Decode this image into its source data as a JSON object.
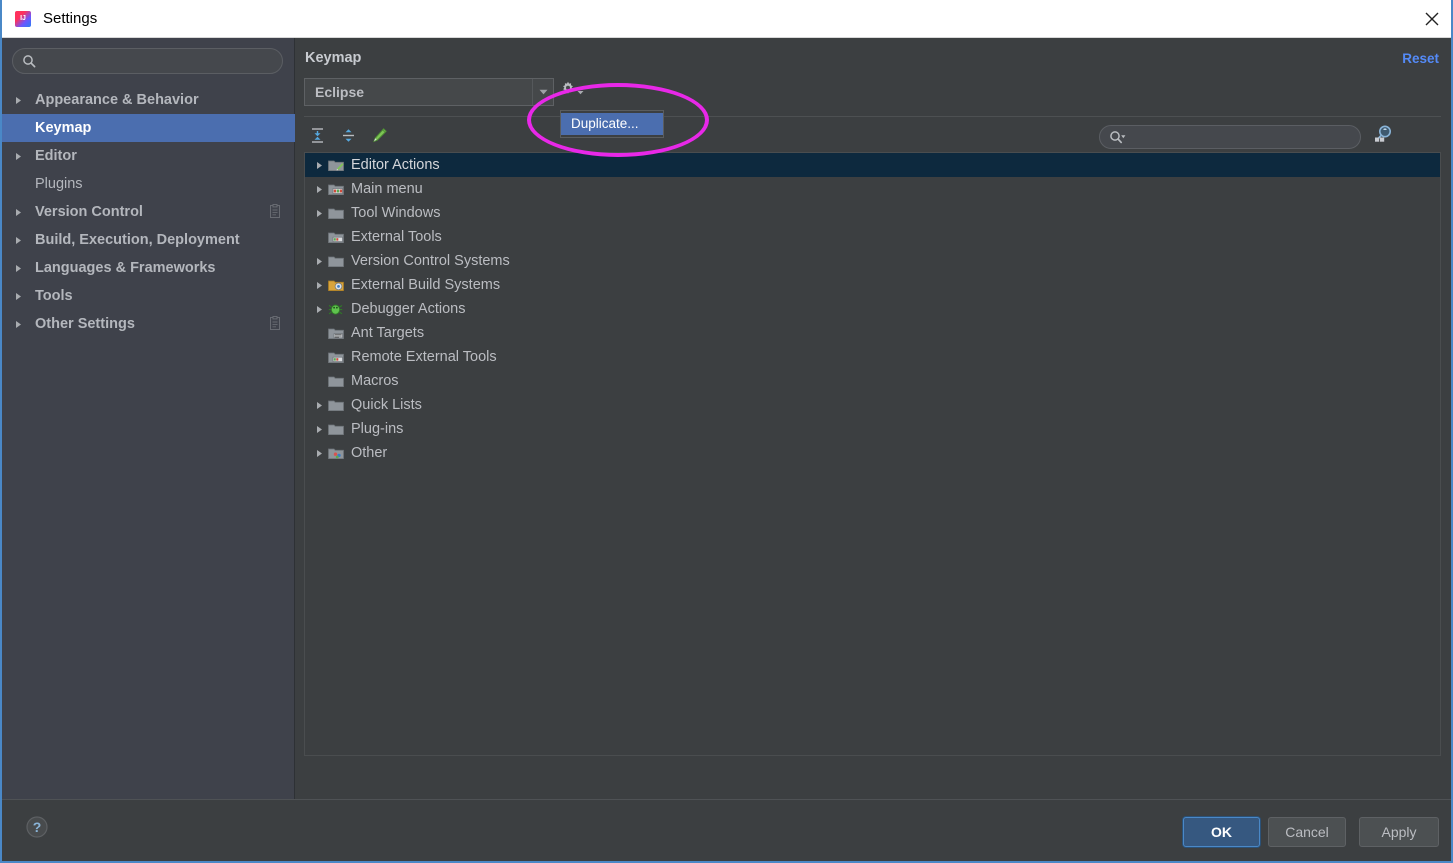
{
  "window": {
    "title": "Settings",
    "app_icon": "intellij-idea-icon",
    "close_icon": "close-icon"
  },
  "sidebar": {
    "search": {
      "value": "",
      "placeholder": "",
      "icon": "search-icon"
    },
    "items": [
      {
        "label": "Appearance & Behavior",
        "expandable": true,
        "selected": false,
        "bold": true,
        "badge": false
      },
      {
        "label": "Keymap",
        "expandable": false,
        "selected": true,
        "bold": true,
        "badge": false
      },
      {
        "label": "Editor",
        "expandable": true,
        "selected": false,
        "bold": true,
        "badge": false
      },
      {
        "label": "Plugins",
        "expandable": false,
        "selected": false,
        "bold": false,
        "badge": false
      },
      {
        "label": "Version Control",
        "expandable": true,
        "selected": false,
        "bold": true,
        "badge": true
      },
      {
        "label": "Build, Execution, Deployment",
        "expandable": true,
        "selected": false,
        "bold": true,
        "badge": false
      },
      {
        "label": "Languages & Frameworks",
        "expandable": true,
        "selected": false,
        "bold": true,
        "badge": false
      },
      {
        "label": "Tools",
        "expandable": true,
        "selected": false,
        "bold": true,
        "badge": false
      },
      {
        "label": "Other Settings",
        "expandable": true,
        "selected": false,
        "bold": true,
        "badge": true
      }
    ]
  },
  "main": {
    "title": "Keymap",
    "reset_label": "Reset",
    "keymap_combo": {
      "value": "Eclipse",
      "arrow_icon": "chevron-down-icon"
    },
    "gear": {
      "icon": "gear-icon",
      "arrow_icon": "chevron-down-icon"
    },
    "popup_menu": {
      "items": [
        {
          "label": "Duplicate...",
          "highlighted": true
        }
      ]
    },
    "toolbar": [
      {
        "name": "expand-all-button",
        "icon": "expand-all-icon",
        "tooltip": "Expand All"
      },
      {
        "name": "collapse-all-button",
        "icon": "collapse-all-icon",
        "tooltip": "Collapse All"
      },
      {
        "name": "edit-shortcut-button",
        "icon": "pencil-icon",
        "tooltip": "Edit Shortcut"
      }
    ],
    "tree_search": {
      "value": "",
      "placeholder": "",
      "icon": "search-dropdown-icon"
    },
    "find_shortcut": {
      "icon": "find-by-shortcut-icon"
    },
    "tree": [
      {
        "label": "Editor Actions",
        "expandable": true,
        "selected": true,
        "icon": "editor-actions-icon"
      },
      {
        "label": "Main menu",
        "expandable": true,
        "selected": false,
        "icon": "main-menu-icon"
      },
      {
        "label": "Tool Windows",
        "expandable": true,
        "selected": false,
        "icon": "folder-icon"
      },
      {
        "label": "External Tools",
        "expandable": false,
        "selected": false,
        "icon": "external-tools-icon"
      },
      {
        "label": "Version Control Systems",
        "expandable": true,
        "selected": false,
        "icon": "folder-icon"
      },
      {
        "label": "External Build Systems",
        "expandable": true,
        "selected": false,
        "icon": "build-systems-icon"
      },
      {
        "label": "Debugger Actions",
        "expandable": true,
        "selected": false,
        "icon": "debugger-bug-icon"
      },
      {
        "label": "Ant Targets",
        "expandable": false,
        "selected": false,
        "icon": "ant-targets-icon"
      },
      {
        "label": "Remote External Tools",
        "expandable": false,
        "selected": false,
        "icon": "remote-external-tools-icon"
      },
      {
        "label": "Macros",
        "expandable": false,
        "selected": false,
        "icon": "folder-icon"
      },
      {
        "label": "Quick Lists",
        "expandable": true,
        "selected": false,
        "icon": "folder-icon"
      },
      {
        "label": "Plug-ins",
        "expandable": true,
        "selected": false,
        "icon": "folder-icon"
      },
      {
        "label": "Other",
        "expandable": true,
        "selected": false,
        "icon": "other-icon"
      }
    ]
  },
  "footer": {
    "help_icon": "help-question-icon",
    "ok_label": "OK",
    "cancel_label": "Cancel",
    "apply_label": "Apply"
  },
  "annotation": {
    "shape": "ellipse",
    "color": "#e828e8",
    "target": "Duplicate..."
  },
  "colors": {
    "sidebar_bg": "#3f424b",
    "panel_bg": "#3c3f41",
    "selection_blue": "#4b6eaf",
    "tree_selection": "#0d293e",
    "accent_link": "#548af7",
    "annotation": "#e828e8",
    "titlebar_bg": "#ffffff",
    "window_border": "#4a88c7"
  }
}
